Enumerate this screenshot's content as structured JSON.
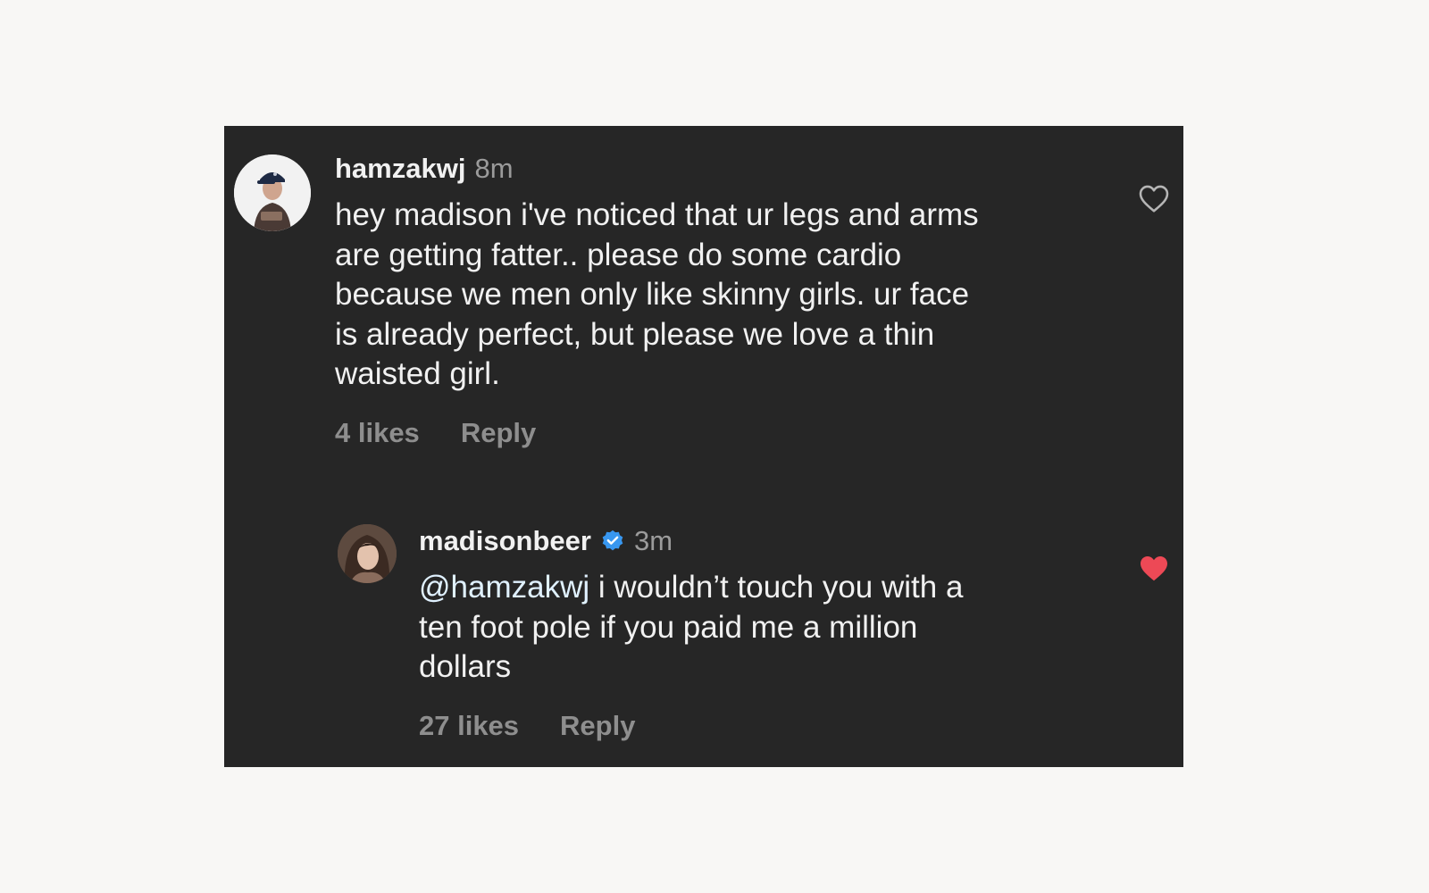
{
  "comment": {
    "username": "hamzakwj",
    "time": "8m",
    "text_lines": [
      "hey madison i've noticed that ur legs and arms",
      "are getting fatter.. please do some cardio",
      "because we men only like skinny girls. ur face",
      "is already perfect, but please we love a thin",
      "waisted girl."
    ],
    "likes": "4 likes",
    "reply_label": "Reply",
    "liked": false
  },
  "reply": {
    "username": "madisonbeer",
    "verified": true,
    "time": "3m",
    "mention": "@hamzakwj",
    "text_lines": [
      " i wouldn’t touch you with a",
      "ten foot pole if you paid me a million",
      "dollars"
    ],
    "likes": "27 likes",
    "reply_label": "Reply",
    "liked": true
  },
  "colors": {
    "panel_background": "#262626",
    "page_background": "#f8f7f5",
    "text_primary": "#f1f1f1",
    "text_secondary": "#8e8e8e",
    "liked_heart": "#ed4956",
    "verified_badge": "#3897f0"
  },
  "icons": {
    "like_outline": "heart-outline-icon",
    "like_filled": "heart-filled-icon",
    "verified": "verified-badge-icon"
  }
}
